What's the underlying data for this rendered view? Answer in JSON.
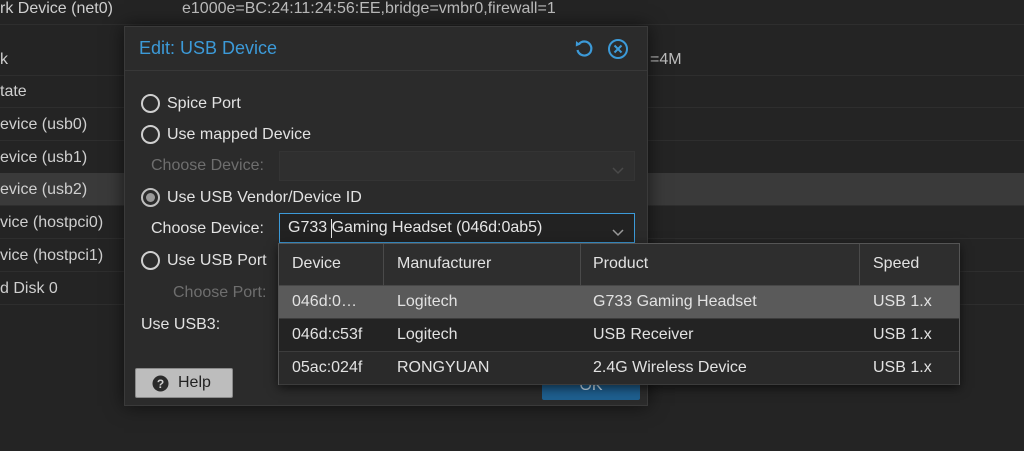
{
  "background": {
    "rows": [
      {
        "key": "rk Device (net0)",
        "value": "e1000e=BC:24:11:24:56:EE,bridge=vmbr0,firewall=1"
      },
      {
        "key": "k",
        "value": "=4M"
      },
      {
        "key": "tate",
        "value": ""
      },
      {
        "key": "evice (usb0)",
        "value": ""
      },
      {
        "key": "evice (usb1)",
        "value": ""
      },
      {
        "key": "evice (usb2)",
        "value": ""
      },
      {
        "key": "vice (hostpci0)",
        "value": ""
      },
      {
        "key": "vice (hostpci1)",
        "value": ""
      },
      {
        "key": "d Disk 0",
        "value": ""
      }
    ]
  },
  "dialog": {
    "title": "Edit: USB Device",
    "options": {
      "spice_port": "Spice Port",
      "mapped_device": "Use mapped Device",
      "vendor_device_id": "Use USB Vendor/Device ID",
      "usb_port": "Use USB Port"
    },
    "selected_option": "vendor_device_id",
    "mapped_choose_label": "Choose Device:",
    "choose_device_label": "Choose Device:",
    "choose_device_value": "G733 Gaming Headset (046d:0ab5)",
    "choose_port_label": "Choose Port:",
    "usb3_label": "Use USB3:",
    "help_label": "Help",
    "ok_label": "OK"
  },
  "device_grid": {
    "columns": [
      "Device",
      "Manufacturer",
      "Product",
      "Speed"
    ],
    "rows": [
      {
        "device": "046d:0…",
        "manufacturer": "Logitech",
        "product": "G733 Gaming Headset",
        "speed": "USB 1.x"
      },
      {
        "device": "046d:c53f",
        "manufacturer": "Logitech",
        "product": "USB Receiver",
        "speed": "USB 1.x"
      },
      {
        "device": "05ac:024f",
        "manufacturer": "RONGYUAN",
        "product": "2.4G Wireless Device",
        "speed": "USB 1.x"
      }
    ],
    "selected_row": 0
  },
  "colors": {
    "accent": "#3c9ad8",
    "background": "#242424",
    "dialog": "#2b2b2b",
    "selected_row": "#5a5a5a"
  },
  "icons": [
    "reset-icon",
    "close-icon",
    "chevron-down-icon",
    "question-icon"
  ]
}
